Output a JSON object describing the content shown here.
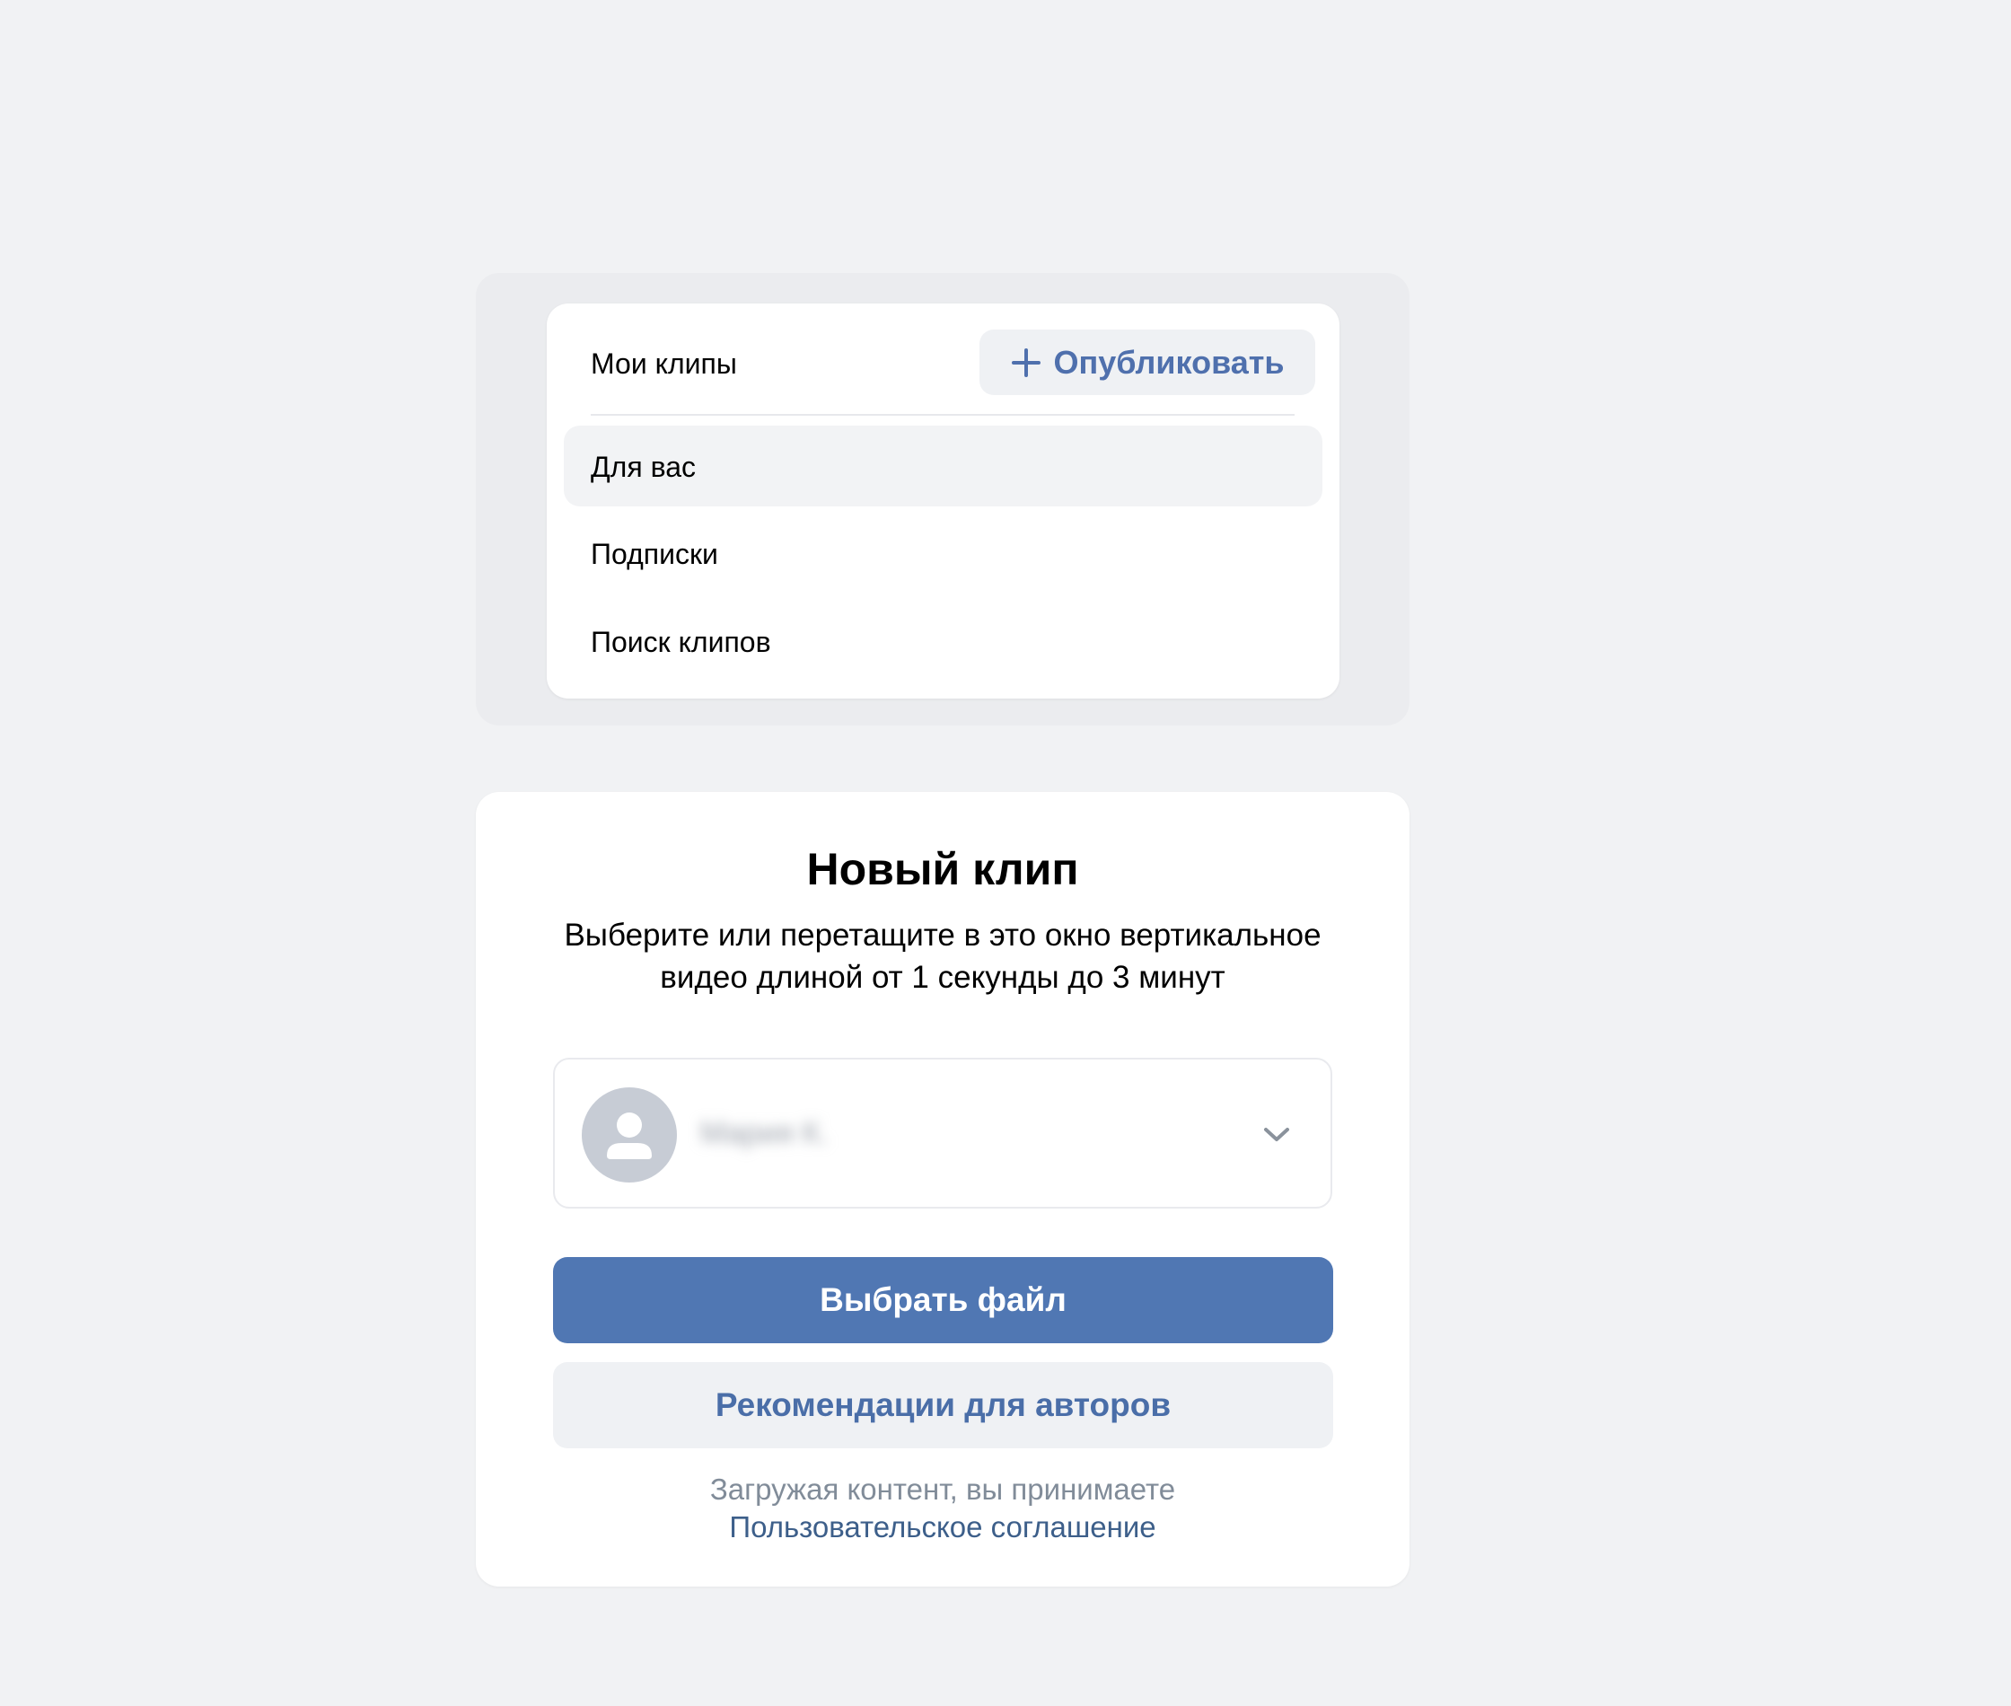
{
  "menu": {
    "title": "Мои клипы",
    "publish_label": "Опубликовать",
    "items": [
      {
        "label": "Для вас",
        "active": true
      },
      {
        "label": "Подписки",
        "active": false
      },
      {
        "label": "Поиск клипов",
        "active": false
      }
    ]
  },
  "new_clip": {
    "title": "Новый клип",
    "description_line1": "Выберите или перетащите в это окно вертикальное",
    "description_line2": "видео длиной от 1 секунды до 3 минут",
    "author_name": "Мария К.",
    "choose_file_label": "Выбрать файл",
    "recommendations_label": "Рекомендации для авторов",
    "terms_text": "Загружая контент, вы принимаете",
    "terms_link": "Пользовательское соглашение"
  },
  "icons": {
    "publish": "plus-icon",
    "avatar": "user-placeholder-icon",
    "dropdown": "chevron-down-icon"
  },
  "colors": {
    "background": "#f1f2f4",
    "accent": "#5077b3",
    "link": "#4a6ea8",
    "secondary_button_bg": "#eff1f4",
    "muted_text": "#818c99"
  }
}
